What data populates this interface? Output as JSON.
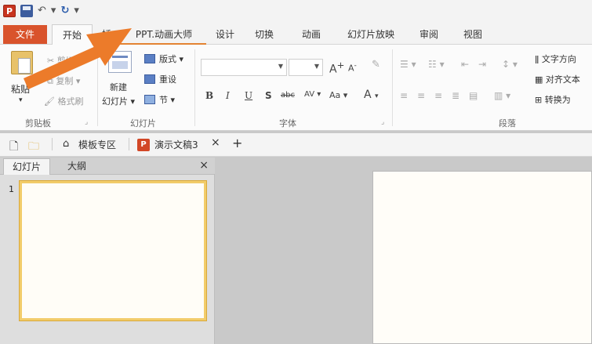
{
  "quick_access": {
    "app_logo": "P",
    "undo_glyph": "↶",
    "redo_glyph": "↻",
    "more_glyph": "▾"
  },
  "tabs": {
    "file": "文件",
    "home": "开始",
    "insert_partial": "插入",
    "ppt_master": "PPT.动画大师",
    "design": "设计",
    "transitions": "切换",
    "animations": "动画",
    "slideshow": "幻灯片放映",
    "review": "审阅",
    "view": "视图"
  },
  "ribbon": {
    "clipboard": {
      "paste": "粘贴",
      "cut": "剪切",
      "copy": "复制",
      "format_painter": "格式刷",
      "label": "剪贴板"
    },
    "slides": {
      "layout": "版式",
      "new_slide_line1": "新建",
      "new_slide_line2": "幻灯片",
      "reset": "重设",
      "section": "节",
      "label": "幻灯片"
    },
    "font": {
      "grow": "A",
      "shrink": "A",
      "bold": "B",
      "italic": "I",
      "underline": "U",
      "shadow": "S",
      "strike": "abc",
      "spacing": "AV",
      "change_case": "Aa",
      "font_color": "A",
      "label": "字体"
    },
    "paragraph": {
      "text_direction": "文字方向",
      "align_text": "对齐文本",
      "convert": "转换为",
      "label": "段落"
    }
  },
  "doc_tabs": {
    "templates": "模板专区",
    "current_doc": "演示文稿3",
    "close": "×",
    "add": "+"
  },
  "left_pane": {
    "tab_slides": "幻灯片",
    "tab_outline": "大纲",
    "close": "×",
    "slide_number": "1"
  },
  "colors": {
    "file_tab": "#d9532c",
    "arrow": "#ec7b2a",
    "thumb_border": "#f2cc6a",
    "underline": "#e38332"
  }
}
